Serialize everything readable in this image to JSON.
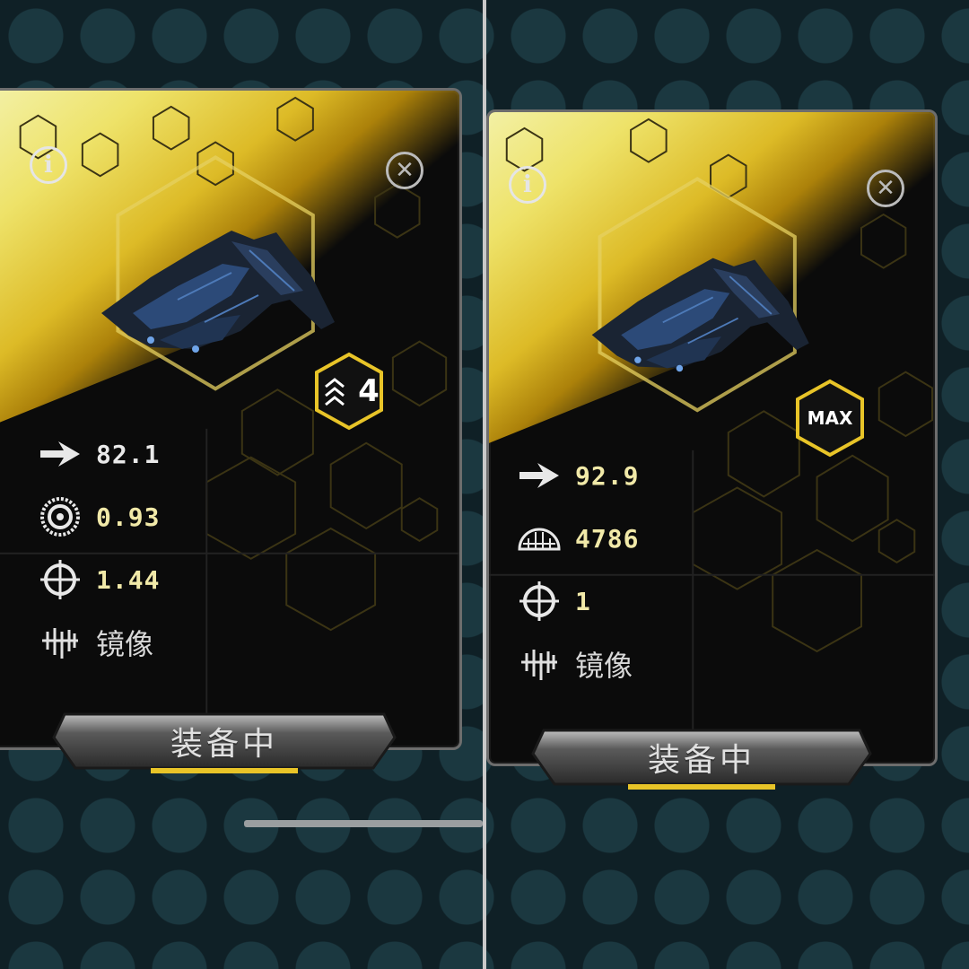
{
  "panels": [
    {
      "id": "left",
      "rank_label": "4",
      "stats": [
        {
          "icon": "arrow-speed-icon",
          "value": "82.1"
        },
        {
          "icon": "gear-wheel-icon",
          "value": "0.93"
        },
        {
          "icon": "crosshair-icon",
          "value": "1.44"
        },
        {
          "icon": "mirror-wave-icon",
          "value": "镜像"
        }
      ],
      "equip_label": "装备中"
    },
    {
      "id": "right",
      "rank_label": "MAX",
      "stats": [
        {
          "icon": "arrow-speed-icon",
          "value": "92.9"
        },
        {
          "icon": "dome-shield-icon",
          "value": "4786"
        },
        {
          "icon": "crosshair-icon",
          "value": "1"
        },
        {
          "icon": "mirror-wave-icon",
          "value": "镜像"
        }
      ],
      "equip_label": "装备中"
    }
  ],
  "colors": {
    "gold": "#e8c428",
    "stat_value": "#f1e9a8",
    "card_bg": "#0b0b0b"
  }
}
